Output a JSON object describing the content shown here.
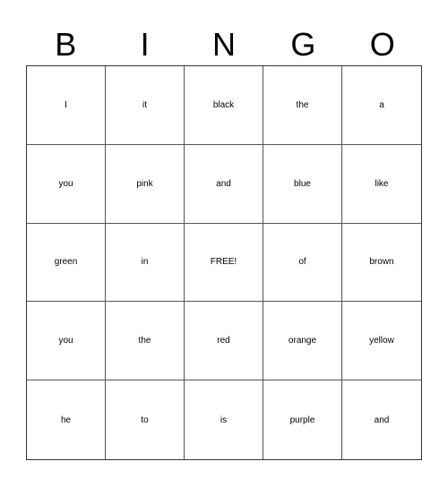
{
  "header": {
    "letters": [
      "B",
      "I",
      "N",
      "G",
      "O"
    ]
  },
  "grid": {
    "rows": [
      [
        "I",
        "it",
        "black",
        "the",
        "a"
      ],
      [
        "you",
        "pink",
        "and",
        "blue",
        "like"
      ],
      [
        "green",
        "in",
        "FREE!",
        "of",
        "brown"
      ],
      [
        "you",
        "the",
        "red",
        "orange",
        "yellow"
      ],
      [
        "he",
        "to",
        "is",
        "purple",
        "and"
      ]
    ]
  }
}
